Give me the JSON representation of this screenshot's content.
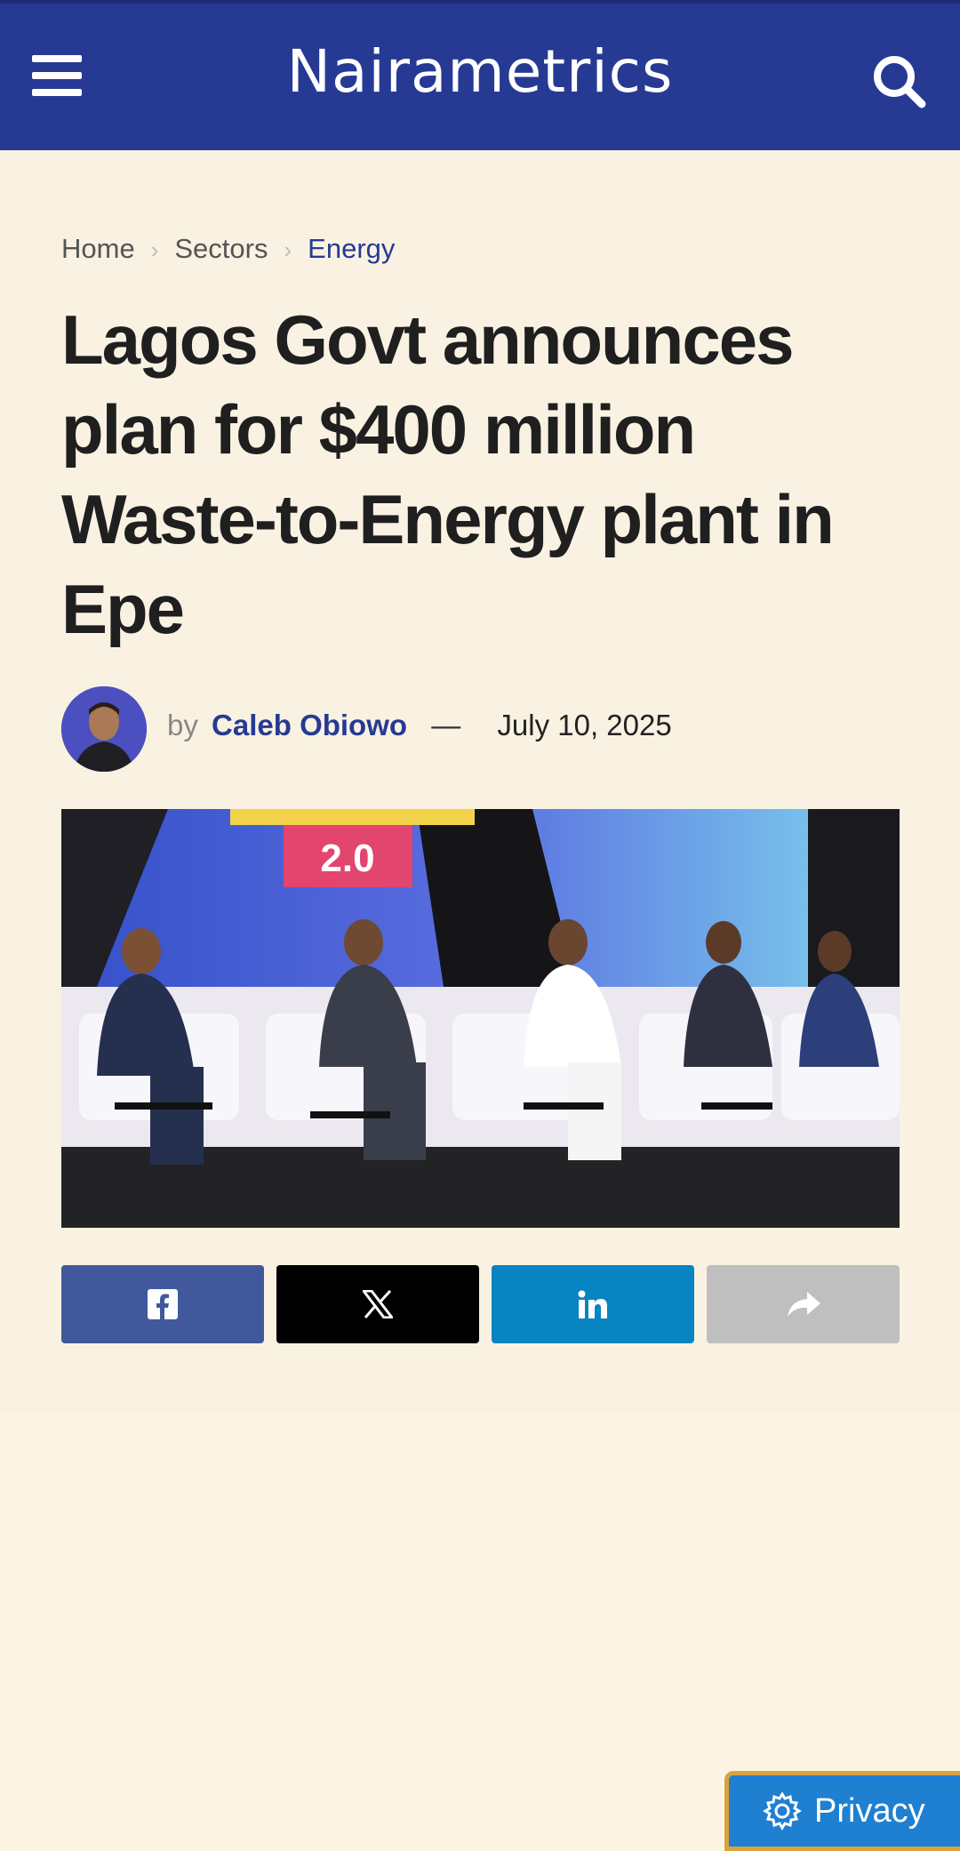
{
  "header": {
    "logo_text": "Nairametrics",
    "menu_icon": "hamburger-menu-icon",
    "search_icon": "search-icon",
    "bg_color": "#263a94"
  },
  "breadcrumb": {
    "items": [
      "Home",
      "Sectors",
      "Energy"
    ],
    "separator_icon": "chevron-right-icon"
  },
  "article": {
    "title": "Lagos Govt announces plan for $400 million Waste-to-Energy plant in Epe",
    "byline_prefix": "by",
    "author": "Caleb Obiowo",
    "dash": "—",
    "date": "July 10, 2025"
  },
  "share": {
    "buttons": [
      {
        "icon": "facebook-icon",
        "color": "#3b5998"
      },
      {
        "icon": "x-twitter-icon",
        "color": "#000000"
      },
      {
        "icon": "linkedin-icon",
        "color": "#0083be"
      },
      {
        "icon": "share-icon",
        "color": "#bdbdbd"
      }
    ]
  },
  "privacy": {
    "label": "Privacy",
    "icon": "gear-icon"
  },
  "hero_image": {
    "banner_text": "2.0"
  }
}
